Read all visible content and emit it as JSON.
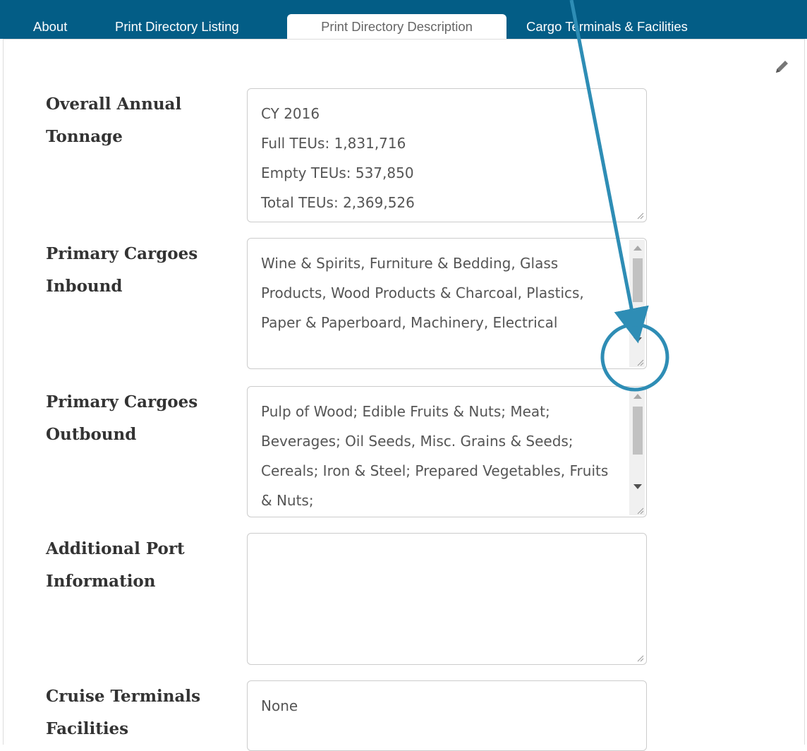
{
  "tabs": [
    {
      "label": "About"
    },
    {
      "label": "Print Directory Listing"
    },
    {
      "label": "Print Directory Description",
      "active": true
    },
    {
      "label": "Cargo Terminals & Facilities"
    }
  ],
  "fields": [
    {
      "label": "Overall Annual\nTonnage",
      "value": "CY 2016\nFull TEUs: 1,831,716\nEmpty TEUs: 537,850\nTotal TEUs: 2,369,526"
    },
    {
      "label": "Primary Cargoes\nInbound",
      "value": "Wine & Spirits, Furniture & Bedding, Glass Products, Wood Products & Charcoal, Plastics, Paper & Paperboard, Machinery, Electrical"
    },
    {
      "label": "Primary Cargoes\nOutbound",
      "value": "Pulp of Wood; Edible Fruits & Nuts; Meat; Beverages; Oil Seeds, Misc. Grains & Seeds; Cereals; Iron & Steel; Prepared Vegetables, Fruits & Nuts;"
    },
    {
      "label": "Additional Port\nInformation",
      "value": ""
    },
    {
      "label": "Cruise Terminals\nFacilities",
      "value": "None"
    }
  ],
  "colors": {
    "tabbar": "#035d86",
    "annotation": "#2e8db5"
  },
  "icons": {
    "edit": "pencil-icon",
    "resize": "resize-grip-icon"
  }
}
